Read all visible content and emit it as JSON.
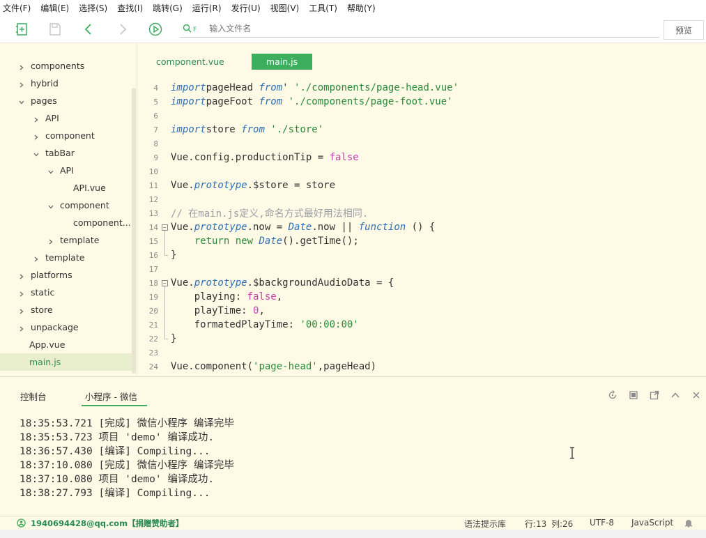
{
  "menu": [
    "文件(F)",
    "编辑(E)",
    "选择(S)",
    "查找(I)",
    "跳转(G)",
    "运行(R)",
    "发行(U)",
    "视图(V)",
    "工具(T)",
    "帮助(Y)"
  ],
  "toolbar": {
    "search_placeholder": "输入文件名",
    "search_prefix": "F",
    "preview": "预览"
  },
  "tree": [
    {
      "label": "components",
      "depth": 0,
      "chevron": "right"
    },
    {
      "label": "hybrid",
      "depth": 0,
      "chevron": "right"
    },
    {
      "label": "pages",
      "depth": 0,
      "chevron": "down"
    },
    {
      "label": "API",
      "depth": 1,
      "chevron": "right"
    },
    {
      "label": "component",
      "depth": 1,
      "chevron": "right"
    },
    {
      "label": "tabBar",
      "depth": 1,
      "chevron": "down"
    },
    {
      "label": "API",
      "depth": 2,
      "chevron": "down"
    },
    {
      "label": "API.vue",
      "depth": 3,
      "chevron": "none"
    },
    {
      "label": "component",
      "depth": 2,
      "chevron": "down"
    },
    {
      "label": "component....",
      "depth": 3,
      "chevron": "none"
    },
    {
      "label": "template",
      "depth": 2,
      "chevron": "right"
    },
    {
      "label": "template",
      "depth": 1,
      "chevron": "right"
    },
    {
      "label": "platforms",
      "depth": 0,
      "chevron": "right"
    },
    {
      "label": "static",
      "depth": 0,
      "chevron": "right"
    },
    {
      "label": "store",
      "depth": 0,
      "chevron": "right"
    },
    {
      "label": "unpackage",
      "depth": 0,
      "chevron": "right"
    },
    {
      "label": "App.vue",
      "depth": 0,
      "chevron": "none"
    },
    {
      "label": "main.js",
      "depth": 0,
      "chevron": "none",
      "active": true
    }
  ],
  "tabs": {
    "component": "component.vue",
    "main": "main.js"
  },
  "code": [
    {
      "n": "4",
      "fold": "",
      "tokens": [
        [
          "kw",
          "import"
        ],
        [
          "",
          "pageHead "
        ],
        [
          "kw",
          "from"
        ],
        [
          "",
          "' "
        ],
        [
          "str",
          "'./components/page-head.vue'"
        ]
      ]
    },
    {
      "n": "5",
      "fold": "",
      "tokens": [
        [
          "kw",
          "import"
        ],
        [
          "",
          "pageFoot "
        ],
        [
          "kw",
          "from"
        ],
        [
          "",
          ""
        ],
        [
          "str",
          " './components/page-foot.vue'"
        ]
      ]
    },
    {
      "n": "6",
      "fold": "",
      "tokens": []
    },
    {
      "n": "7",
      "fold": "",
      "tokens": [
        [
          "kw",
          "import"
        ],
        [
          "",
          "store "
        ],
        [
          "kw",
          "from"
        ],
        [
          "str",
          " './store'"
        ]
      ]
    },
    {
      "n": "8",
      "fold": "",
      "tokens": []
    },
    {
      "n": "9",
      "fold": "",
      "tokens": [
        [
          "",
          "Vue.config.productionTip = "
        ],
        [
          "bool",
          "false"
        ]
      ]
    },
    {
      "n": "10",
      "fold": "",
      "tokens": []
    },
    {
      "n": "11",
      "fold": "",
      "tokens": [
        [
          "",
          "Vue."
        ],
        [
          "kw",
          "prototype"
        ],
        [
          "",
          ".$store = store"
        ]
      ]
    },
    {
      "n": "12",
      "fold": "",
      "tokens": []
    },
    {
      "n": "13",
      "fold": "",
      "tokens": [
        [
          "cm",
          "// 在main.js定义,命名方式最好用法相同."
        ]
      ]
    },
    {
      "n": "14",
      "fold": "box",
      "tokens": [
        [
          "",
          "Vue."
        ],
        [
          "kw",
          "prototype"
        ],
        [
          "",
          ".now = "
        ],
        [
          "kw",
          "Date"
        ],
        [
          "",
          ".now || "
        ],
        [
          "kw",
          "function"
        ],
        [
          "",
          " () {"
        ]
      ]
    },
    {
      "n": "15",
      "fold": "",
      "tokens": [
        [
          "",
          "    "
        ],
        [
          "str",
          "return"
        ],
        [
          "",
          ""
        ],
        [
          "str",
          " new"
        ],
        [
          "",
          " "
        ],
        [
          "kw",
          "Date"
        ],
        [
          "",
          "().getTime();"
        ]
      ]
    },
    {
      "n": "16",
      "fold": "end",
      "tokens": [
        [
          "",
          "}"
        ]
      ]
    },
    {
      "n": "17",
      "fold": "",
      "tokens": []
    },
    {
      "n": "18",
      "fold": "box",
      "tokens": [
        [
          "",
          "Vue."
        ],
        [
          "kw",
          "prototype"
        ],
        [
          "",
          ".$backgroundAudioData = {"
        ]
      ]
    },
    {
      "n": "19",
      "fold": "",
      "tokens": [
        [
          "",
          "    playing: "
        ],
        [
          "bool",
          "false"
        ],
        [
          "",
          ","
        ]
      ]
    },
    {
      "n": "20",
      "fold": "",
      "tokens": [
        [
          "",
          "    playTime: "
        ],
        [
          "num",
          "0"
        ],
        [
          "",
          ","
        ]
      ]
    },
    {
      "n": "21",
      "fold": "",
      "tokens": [
        [
          "",
          "    formatedPlayTime: "
        ],
        [
          "str",
          "'00:00:00'"
        ]
      ]
    },
    {
      "n": "22",
      "fold": "end",
      "tokens": [
        [
          "",
          "}"
        ]
      ]
    },
    {
      "n": "23",
      "fold": "",
      "tokens": []
    },
    {
      "n": "24",
      "fold": "",
      "tokens": [
        [
          "",
          "Vue.component("
        ],
        [
          "str",
          "'page-head'"
        ],
        [
          "",
          ",pageHead)"
        ]
      ]
    }
  ],
  "console": {
    "tab_console": "控制台",
    "tab_wechat": "小程序 - 微信",
    "logs": [
      "18:35:53.721 [完成] 微信小程序 编译完毕",
      "18:35:53.723 项目 'demo' 编译成功.",
      "18:36:57.430 [编译] Compiling...",
      "18:37:10.080 [完成] 微信小程序 编译完毕",
      "18:37:10.080 项目 'demo' 编译成功.",
      "18:38:27.793 [编译] Compiling..."
    ]
  },
  "status": {
    "account": "1940694428@qq.com【捐赠赞助者】",
    "hint_lib": "语法提示库",
    "row": "行:13",
    "col": "列:26",
    "encoding": "UTF-8",
    "language": "JavaScript"
  },
  "colors": {
    "accent": "#3cae5e",
    "background": "#fffae6",
    "keyword": "#2d6fb3",
    "string": "#2a8a3a",
    "boolean": "#c040b0",
    "comment": "#9aa0a6"
  }
}
